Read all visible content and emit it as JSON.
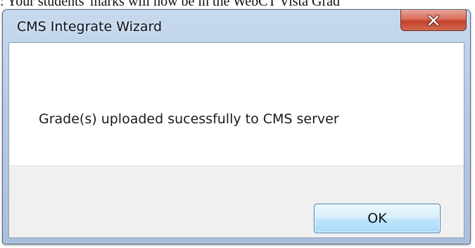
{
  "document": {
    "partial_text": ": Your students' marks will now be in the WebCT Vista Grad"
  },
  "dialog": {
    "title": "CMS Integrate Wizard",
    "message": "Grade(s) uploaded sucessfully to CMS server",
    "ok_label": "OK",
    "close_icon": "close-icon"
  }
}
